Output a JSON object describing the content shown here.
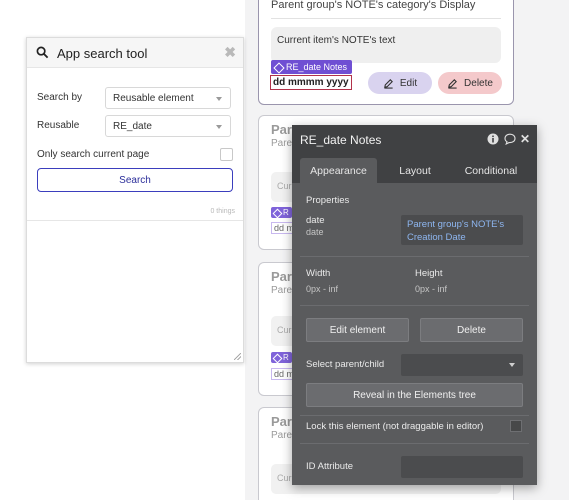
{
  "canvas": {
    "card1": {
      "category_text": "Parent group's NOTE's category's Display",
      "text_box": "Current item's NOTE's text",
      "badge": "RE_date Notes",
      "date_format": "dd mmmm yyyy",
      "edit_label": "Edit",
      "delete_label": "Delete"
    },
    "card2": {
      "title": "Pare",
      "sub": "Pare",
      "box": "Cur",
      "badge": "R",
      "date": "dd m"
    },
    "card3": {
      "title": "Pare",
      "sub": "Pare",
      "box": "Cur",
      "badge": "R",
      "date": "dd m"
    },
    "card4": {
      "title": "Pare",
      "sub": "Pare",
      "box": "Cur"
    }
  },
  "search_tool": {
    "title": "App search tool",
    "search_by_label": "Search by",
    "search_by_value": "Reusable element",
    "reusable_label": "Reusable",
    "reusable_value": "RE_date",
    "only_current_label": "Only search current page",
    "only_current_checked": false,
    "search_button": "Search",
    "result_count": "0 things"
  },
  "property_editor": {
    "title": "RE_date Notes",
    "icons": [
      "info-icon",
      "comment-icon",
      "close-icon"
    ],
    "tabs": [
      {
        "label": "Appearance",
        "active": true
      },
      {
        "label": "Layout",
        "active": false
      },
      {
        "label": "Conditional",
        "active": false
      }
    ],
    "properties_label": "Properties",
    "date_name": "date",
    "date_type": "date",
    "date_value": "Parent group's NOTE's Creation Date",
    "width_label": "Width",
    "width_value": "0px - inf",
    "height_label": "Height",
    "height_value": "0px - inf",
    "edit_element": "Edit element",
    "delete": "Delete",
    "select_parent_label": "Select parent/child",
    "reveal_label": "Reveal in the Elements tree",
    "lock_label": "Lock this element (not draggable in editor)",
    "id_attribute_label": "ID Attribute"
  }
}
